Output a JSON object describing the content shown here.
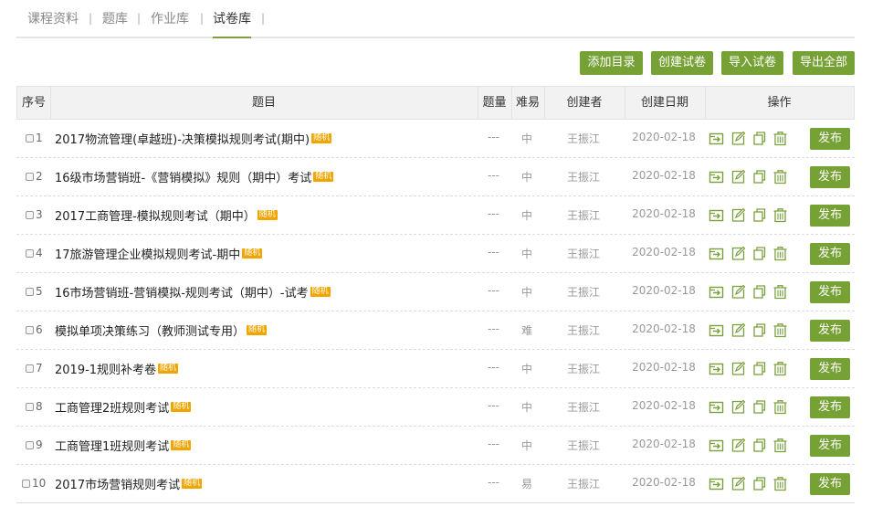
{
  "tabs": [
    {
      "label": "课程资料"
    },
    {
      "label": "题库"
    },
    {
      "label": "作业库"
    },
    {
      "label": "试卷库"
    }
  ],
  "active_tab": "试卷库",
  "toolbar": {
    "add_dir": "添加目录",
    "create_paper": "创建试卷",
    "import_paper": "导入试卷",
    "export_all": "导出全部"
  },
  "table": {
    "headers": {
      "index": "序号",
      "title": "题目",
      "count": "题量",
      "difficulty": "难易",
      "creator": "创建者",
      "date": "创建日期",
      "ops": "操作"
    },
    "tag_label": "随机",
    "publish_label": "发布",
    "rows": [
      {
        "index": "1",
        "title": "2017物流管理(卓越班)-决策模拟规则考试(期中)",
        "count": "---",
        "difficulty": "中",
        "creator": "王振江",
        "date": "2020-02-18"
      },
      {
        "index": "2",
        "title": "16级市场营销班-《营销模拟》规则（期中）考试",
        "count": "---",
        "difficulty": "中",
        "creator": "王振江",
        "date": "2020-02-18"
      },
      {
        "index": "3",
        "title": "2017工商管理-模拟规则考试（期中）",
        "count": "---",
        "difficulty": "中",
        "creator": "王振江",
        "date": "2020-02-18"
      },
      {
        "index": "4",
        "title": "17旅游管理企业模拟规则考试-期中",
        "count": "---",
        "difficulty": "中",
        "creator": "王振江",
        "date": "2020-02-18"
      },
      {
        "index": "5",
        "title": "16市场营销班-营销模拟-规则考试（期中）-试考",
        "count": "---",
        "difficulty": "中",
        "creator": "王振江",
        "date": "2020-02-18"
      },
      {
        "index": "6",
        "title": "模拟单项决策练习（教师测试专用）",
        "count": "---",
        "difficulty": "难",
        "creator": "王振江",
        "date": "2020-02-18"
      },
      {
        "index": "7",
        "title": "2019-1规则补考卷",
        "count": "---",
        "difficulty": "中",
        "creator": "王振江",
        "date": "2020-02-18"
      },
      {
        "index": "8",
        "title": "工商管理2班规则考试",
        "count": "---",
        "difficulty": "中",
        "creator": "王振江",
        "date": "2020-02-18"
      },
      {
        "index": "9",
        "title": "工商管理1班规则考试",
        "count": "---",
        "difficulty": "中",
        "creator": "王振江",
        "date": "2020-02-18"
      },
      {
        "index": "10",
        "title": "2017市场营销规则考试",
        "count": "---",
        "difficulty": "易",
        "creator": "王振江",
        "date": "2020-02-18"
      }
    ]
  },
  "icons": {
    "move": "move-to-folder-icon",
    "edit": "edit-icon",
    "copy": "copy-icon",
    "delete": "trash-icon"
  },
  "colors": {
    "accent": "#76a135",
    "tag": "#f0a500",
    "icon": "#7aa03e"
  }
}
